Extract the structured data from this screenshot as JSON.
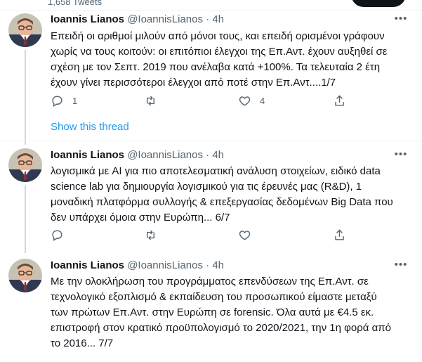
{
  "profile_header": {
    "tweet_count": "1,658 Tweets"
  },
  "tweets": [
    {
      "name": "Ioannis Lianos",
      "handle": "@IoannisLianos",
      "separator": "·",
      "time": "4h",
      "text": "Επειδή οι αριθμοί μιλούν από μόνοι τους, και επειδή ορισμένοι γράφουν\nχωρίς να τους κοιτούν: οι επιτόπιοι έλεγχοι της Επ.Αντ. έχουν αυξηθεί σε\nσχέση με τον Σεπτ. 2019 που ανέλαβα κατά +100%. Τα τελευταία 2 έτη\nέχουν γίνει περισσότεροι έλεγχοι από ποτέ στην Επ.Αντ....1/7",
      "reply_count": "1",
      "retweet_count": "",
      "like_count": "4"
    },
    {
      "name": "Ioannis Lianos",
      "handle": "@IoannisLianos",
      "separator": "·",
      "time": "4h",
      "text": "λογισμικά με AI για πιο αποτελεσματική ανάλυση στοιχείων, ειδικό data\nscience lab για δημιουργία λογισμικού για τις έρευνές μας (R&D), 1\nμοναδική πλατφόρμα συλλογής & επεξεργασίας δεδομένων Big Data που\nδεν υπάρχει όμοια στην Ευρώπη... 6/7",
      "reply_count": "",
      "retweet_count": "",
      "like_count": ""
    },
    {
      "name": "Ioannis Lianos",
      "handle": "@IoannisLianos",
      "separator": "·",
      "time": "4h",
      "text": "Με την ολοκλήρωση του προγράμματος επενδύσεων της Επ.Αντ. σε\nτεχνολογικό εξοπλισμό & εκπαίδευση του προσωπικού είμαστε μεταξύ\nτων πρώτων Επ.Αντ. στην Ευρώπη σε forensic. Όλα αυτά με €4.5 εκ.\nεπιστροφή στον κρατικό προϋπολογισμό το 2020/2021, την 1η φορά από\nτο 2016... 7/7",
      "reply_count": "",
      "retweet_count": "",
      "like_count": ""
    }
  ],
  "show_thread": "Show this thread",
  "icons": {
    "reply": "reply-icon",
    "retweet": "retweet-icon",
    "like": "heart-icon",
    "share": "share-icon",
    "more": "more-icon"
  },
  "colors": {
    "link": "#1d9bf0",
    "muted": "#536471",
    "text": "#0f1419",
    "divider": "#eff3f4",
    "thread_line": "#cfd9de"
  }
}
